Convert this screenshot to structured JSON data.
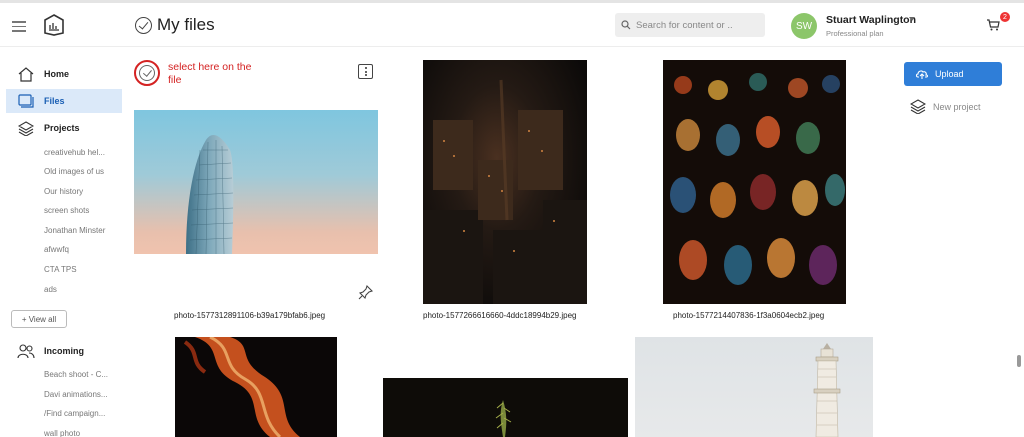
{
  "header": {
    "title": "My files",
    "search_placeholder": "Search for content or ..",
    "user": {
      "initials": "SW",
      "name": "Stuart Waplington",
      "plan": "Professional plan"
    },
    "cart_count": "2"
  },
  "sidebar": {
    "nav": [
      {
        "label": "Home",
        "icon": "home-icon"
      },
      {
        "label": "Files",
        "icon": "files-icon",
        "active": true
      },
      {
        "label": "Projects",
        "icon": "layers-icon"
      },
      {
        "label": "Incoming",
        "icon": "users-icon"
      }
    ],
    "projects": [
      "creativehub hel...",
      "Old images of us",
      "Our history",
      "screen shots",
      "Jonathan Minster",
      "afwwfq",
      "CTA TPS",
      "ads"
    ],
    "view_all": "+ View all",
    "incoming": [
      "Beach shoot - C...",
      "Davi animations...",
      "/Find campaign...",
      "wall photo"
    ]
  },
  "annotation": "select here on the file",
  "files": [
    {
      "name": "photo-1577312891106-b39a179bfab6.jpeg"
    },
    {
      "name": "photo-1577266616660-4ddc18994b29.jpeg"
    },
    {
      "name": "photo-1577214407836-1f3a0604ecb2.jpeg"
    }
  ],
  "actions": {
    "upload": "Upload",
    "new_project": "New project"
  },
  "colors": {
    "accent": "#2f7ed8",
    "annotation": "#d42222",
    "active_nav_bg": "#dbe9f9",
    "avatar": "#8cc66a"
  }
}
